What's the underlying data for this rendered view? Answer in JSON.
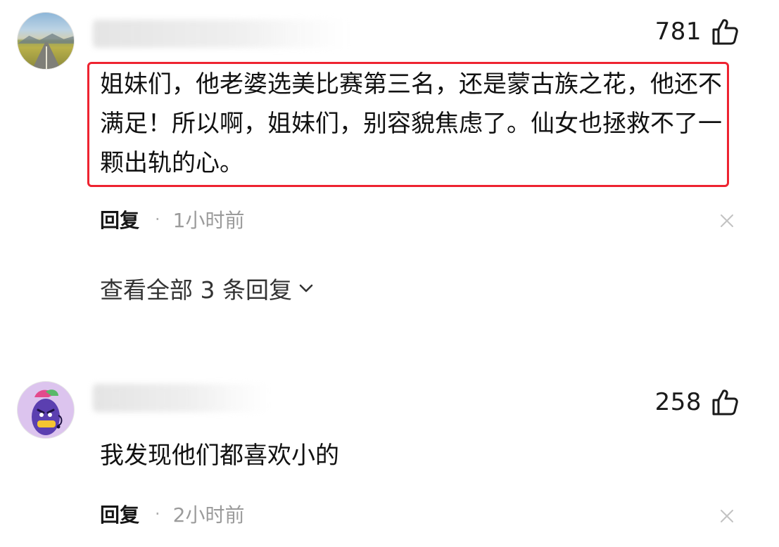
{
  "comments": [
    {
      "like_count": "781",
      "text": "姐妹们，他老婆选美比赛第三名，还是蒙古族之花，他还不满足！所以啊，姐妹们，别容貌焦虑了。仙女也拯救不了一颗出轨的心。",
      "reply_label": "回复",
      "separator": "·",
      "time": "1小时前",
      "view_replies_label": "查看全部 3 条回复",
      "highlight_color": "#ee2330"
    },
    {
      "like_count": "258",
      "text": "我发现他们都喜欢小的",
      "reply_label": "回复",
      "separator": "·",
      "time": "2小时前"
    }
  ],
  "icons": {
    "like": "thumbs-up-icon",
    "close": "close-icon",
    "expand": "chevron-down-icon"
  }
}
